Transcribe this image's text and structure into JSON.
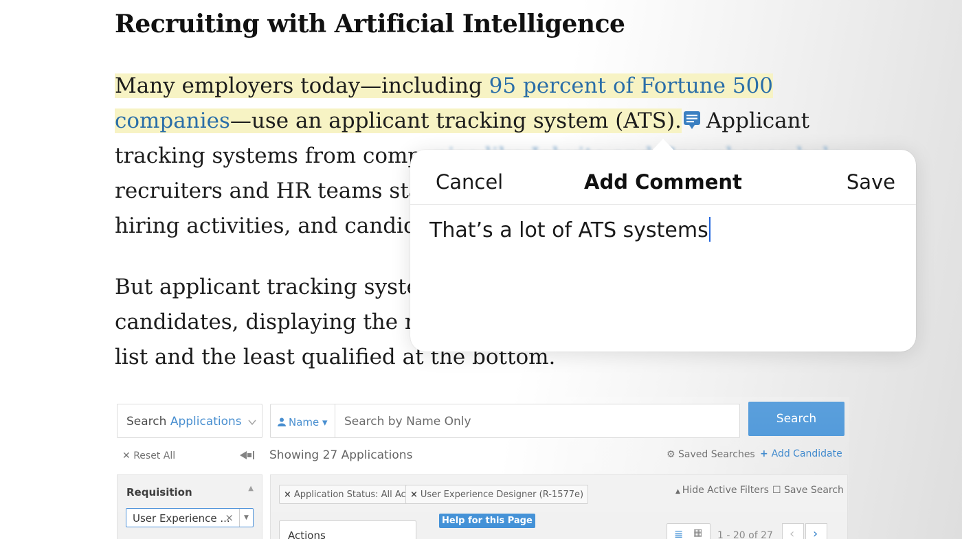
{
  "article": {
    "title": "Recruiting with Artificial Intelligence",
    "para1": {
      "line1_a": "Many employers today—including ",
      "line1_link": "95 percent of Fortune 500",
      "line2_link": "companies",
      "line2_b": "—use an applicant tracking system (ATS).",
      "line2_c": "Applicant",
      "line3_a": "tracking systems from compa",
      "line3_blur": "nies like Jobvite and Greenhouse help",
      "line4": "recruiters and HR teams stay",
      "line5": "hiring activities, and candida"
    },
    "para2": {
      "line1": "But applicant tracking system",
      "line2": "candidates, displaying the mo",
      "line3": "list and the least qualified at the bottom."
    }
  },
  "comment_popover": {
    "cancel_label": "Cancel",
    "title": "Add Comment",
    "save_label": "Save",
    "text": "That’s a lot of ATS systems"
  },
  "ats_ui": {
    "search_apps_label_prefix": "Search ",
    "search_apps_label_link": "Applications",
    "name_dropdown": "Name",
    "search_placeholder": "Search by Name Only",
    "search_button": "Search",
    "reset_all": "Reset All",
    "showing": "Showing 27 Applications",
    "saved_searches": "Saved Searches",
    "add_candidate": "Add Candidate",
    "requisition_label": "Requisition",
    "requisition_value": "User Experience ...",
    "chip1": "Application Status: All Active",
    "chip2": "User Experience Designer (R-1577e)",
    "hide_filters": "Hide Active Filters",
    "save_search": "Save Search",
    "actions_label": "Actions",
    "help_badge": "Help for this Page",
    "pager_text": "1 - 20 of 27"
  },
  "colors": {
    "highlight": "#f7f3c4",
    "link": "#2a6ea8",
    "caret": "#2266dd",
    "search_button": "#3f8fd6"
  }
}
